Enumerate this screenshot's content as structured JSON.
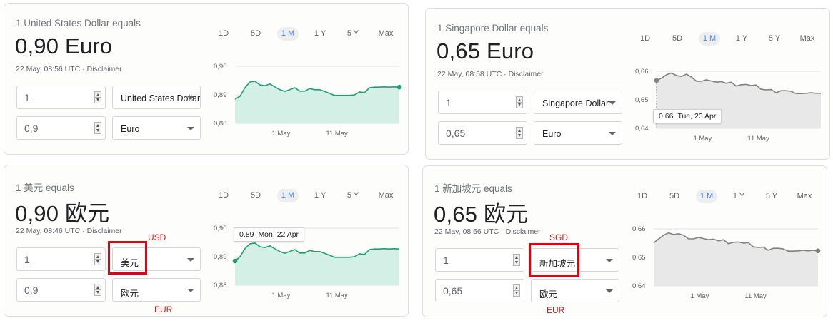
{
  "annotations": {
    "usd": "USD",
    "eur": "EUR",
    "sgd": "SGD"
  },
  "widgets": [
    {
      "equals": "1 United States Dollar equals",
      "result": "0,90 Euro",
      "timestamp": "22 May, 08:56 UTC",
      "disclaimer": "Disclaimer",
      "amount_from": "1",
      "amount_to": "0,9",
      "currency_from": "United States Dollar",
      "currency_to": "Euro",
      "ranges": [
        "1D",
        "5D",
        "1 M",
        "1 Y",
        "5 Y",
        "Max"
      ],
      "active_range": "1 M",
      "chart_data": {
        "type": "area",
        "color": "#1e9e77",
        "fill": "#d3efe6",
        "y_ticks": [
          "0,90",
          "0,89",
          "0,88"
        ],
        "ylim": [
          0.88,
          0.9
        ],
        "x_ticks": [
          "1 May",
          "11 May"
        ],
        "values": [
          0.8885,
          0.8895,
          0.8925,
          0.8945,
          0.8948,
          0.8935,
          0.8932,
          0.8938,
          0.8928,
          0.8918,
          0.8912,
          0.8918,
          0.8925,
          0.8913,
          0.8913,
          0.8922,
          0.8918,
          0.8918,
          0.8912,
          0.8905,
          0.8898,
          0.8898,
          0.8898,
          0.8898,
          0.89,
          0.891,
          0.8908,
          0.8925,
          0.8927,
          0.8927,
          0.8928,
          0.8927,
          0.8928,
          0.8927
        ],
        "endpoint": "end"
      }
    },
    {
      "equals": "1 Singapore Dollar equals",
      "result": "0,65 Euro",
      "timestamp": "22 May, 08:58 UTC",
      "disclaimer": "Disclaimer",
      "amount_from": "1",
      "amount_to": "0,65",
      "currency_from": "Singapore Dollar",
      "currency_to": "Euro",
      "ranges": [
        "1D",
        "5D",
        "1 M",
        "1 Y",
        "5 Y",
        "Max"
      ],
      "active_range": "1 M",
      "tooltip": {
        "value": "0,66",
        "date": "Tue, 23 Apr"
      },
      "chart_data": {
        "type": "area",
        "color": "#808080",
        "fill": "#e8e8e8",
        "y_ticks": [
          "0,66",
          "0,65",
          "0,64"
        ],
        "ylim": [
          0.64,
          0.66
        ],
        "x_ticks": [
          "1 May",
          "11 May"
        ],
        "values": [
          0.6568,
          0.6576,
          0.6588,
          0.6594,
          0.6585,
          0.6582,
          0.659,
          0.658,
          0.6565,
          0.6565,
          0.657,
          0.6566,
          0.6562,
          0.6564,
          0.6558,
          0.6562,
          0.6548,
          0.6553,
          0.6554,
          0.655,
          0.6552,
          0.6537,
          0.6535,
          0.6536,
          0.6525,
          0.6532,
          0.6532,
          0.653,
          0.6522,
          0.6522,
          0.6523,
          0.6525,
          0.6523,
          0.6523
        ],
        "endpoint": "start"
      }
    },
    {
      "equals": "1 美元 equals",
      "result": "0,90 欧元",
      "timestamp": "22 May, 08:46 UTC",
      "disclaimer": "Disclaimer",
      "amount_from": "1",
      "amount_to": "0,9",
      "currency_from": "美元",
      "currency_to": "欧元",
      "ranges": [
        "1D",
        "5D",
        "1 M",
        "1 Y",
        "5 Y",
        "Max"
      ],
      "active_range": "1 M",
      "tooltip": {
        "value": "0,89",
        "date": "Mon, 22 Apr"
      },
      "chart_data": {
        "type": "area",
        "color": "#1e9e77",
        "fill": "#d3efe6",
        "y_ticks": [
          "0,90",
          "0,89",
          "0,88"
        ],
        "ylim": [
          0.88,
          0.9
        ],
        "x_ticks": [
          "1 May",
          "11 May"
        ],
        "values": [
          0.8885,
          0.89,
          0.8928,
          0.8945,
          0.8948,
          0.8935,
          0.8932,
          0.8938,
          0.8928,
          0.8918,
          0.8912,
          0.8918,
          0.8925,
          0.8913,
          0.8913,
          0.8922,
          0.8918,
          0.8918,
          0.8912,
          0.8905,
          0.8898,
          0.8898,
          0.8898,
          0.8898,
          0.89,
          0.891,
          0.8908,
          0.8925,
          0.8927,
          0.8927,
          0.8928,
          0.8927,
          0.8928,
          0.8927
        ],
        "endpoint": "start"
      }
    },
    {
      "equals": "1 新加坡元 equals",
      "result": "0,65 欧元",
      "timestamp": "22 May, 08:56 UTC",
      "disclaimer": "Disclaimer",
      "amount_from": "1",
      "amount_to": "0,65",
      "currency_from": "新加坡元",
      "currency_to": "欧元",
      "ranges": [
        "1D",
        "5D",
        "1 M",
        "1 Y",
        "5 Y",
        "Max"
      ],
      "active_range": "1 M",
      "chart_data": {
        "type": "area",
        "color": "#808080",
        "fill": "#e8e8e8",
        "y_ticks": [
          "0,66",
          "0,65",
          "0,64"
        ],
        "ylim": [
          0.64,
          0.66
        ],
        "x_ticks": [
          "1 May",
          "11 May"
        ],
        "values": [
          0.6551,
          0.6565,
          0.6578,
          0.6586,
          0.658,
          0.6583,
          0.6578,
          0.6565,
          0.6565,
          0.657,
          0.6566,
          0.6562,
          0.6564,
          0.6558,
          0.6562,
          0.6548,
          0.6553,
          0.6554,
          0.655,
          0.6552,
          0.6537,
          0.6535,
          0.6536,
          0.6525,
          0.6532,
          0.6532,
          0.653,
          0.6522,
          0.6522,
          0.6523,
          0.6525,
          0.6523,
          0.6525,
          0.6523
        ],
        "endpoint": "end"
      }
    }
  ]
}
